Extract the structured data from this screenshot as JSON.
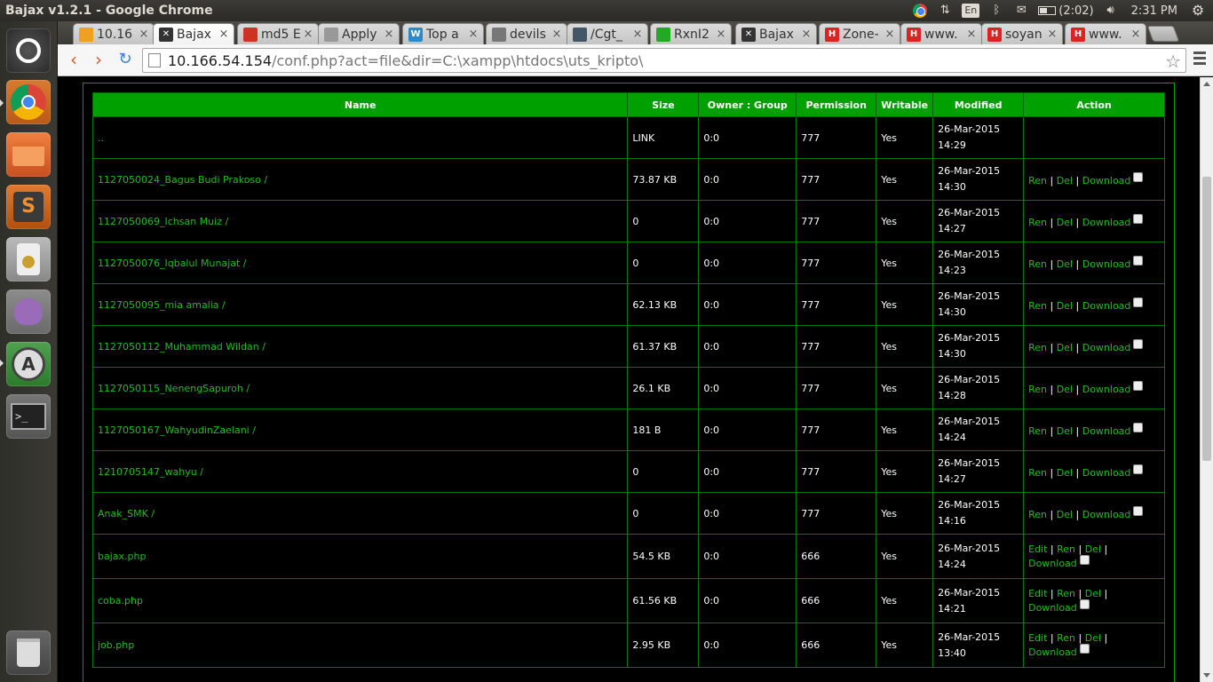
{
  "panel": {
    "window_title": "Bajax v1.2.1 - Google Chrome",
    "lang": "En",
    "battery": "(2:02)",
    "time": "2:31 PM"
  },
  "tabs": [
    {
      "label": "10.16",
      "icon": "phpmyadmin-icon",
      "color": "#f0a020"
    },
    {
      "label": "Bajax",
      "icon": "bajax-icon",
      "color": "#333333"
    },
    {
      "label": "md5 E",
      "icon": "md5-icon",
      "color": "#cc3322"
    },
    {
      "label": "Apply",
      "icon": "loading-icon",
      "color": "#999999"
    },
    {
      "label": "Top a",
      "icon": "wordpress-icon",
      "color": "#2a8bcc"
    },
    {
      "label": "devils",
      "icon": "grid-icon",
      "color": "#777777"
    },
    {
      "label": "/Cgt_",
      "icon": "globe-icon",
      "color": "#445566"
    },
    {
      "label": "RxnI2",
      "icon": "green-dot-icon",
      "color": "#22aa22"
    },
    {
      "label": "Bajax",
      "icon": "bajax-icon",
      "color": "#333333"
    },
    {
      "label": "Zone-",
      "icon": "h-icon",
      "color": "#dd2222"
    },
    {
      "label": "www.",
      "icon": "h-icon",
      "color": "#dd2222"
    },
    {
      "label": "soyan",
      "icon": "h-icon",
      "color": "#dd2222"
    },
    {
      "label": "www.",
      "icon": "h-icon",
      "color": "#dd2222"
    }
  ],
  "address": {
    "host": "10.166.54.154",
    "path": "/conf.php?act=file&dir=C:\\xampp\\htdocs\\uts_kripto\\"
  },
  "table": {
    "headers": [
      "Name",
      "Size",
      "Owner : Group",
      "Permission",
      "Writable",
      "Modified",
      "Action"
    ],
    "rows": [
      {
        "name": "..",
        "size": "LINK",
        "owner": "0:0",
        "perm": "777",
        "writable": "Yes",
        "date": "26-Mar-2015",
        "time": "14:29",
        "kind": "link"
      },
      {
        "name": "1127050024_Bagus Budi Prakoso /",
        "size": "73.87 KB",
        "owner": "0:0",
        "perm": "777",
        "writable": "Yes",
        "date": "26-Mar-2015",
        "time": "14:30",
        "kind": "dir"
      },
      {
        "name": "1127050069_Ichsan Muiz /",
        "size": "0",
        "owner": "0:0",
        "perm": "777",
        "writable": "Yes",
        "date": "26-Mar-2015",
        "time": "14:27",
        "kind": "dir"
      },
      {
        "name": "1127050076_Iqbalul Munajat /",
        "size": "0",
        "owner": "0:0",
        "perm": "777",
        "writable": "Yes",
        "date": "26-Mar-2015",
        "time": "14:23",
        "kind": "dir"
      },
      {
        "name": "1127050095_mia amalia /",
        "size": "62.13 KB",
        "owner": "0:0",
        "perm": "777",
        "writable": "Yes",
        "date": "26-Mar-2015",
        "time": "14:30",
        "kind": "dir"
      },
      {
        "name": "1127050112_Muhammad Wildan /",
        "size": "61.37 KB",
        "owner": "0:0",
        "perm": "777",
        "writable": "Yes",
        "date": "26-Mar-2015",
        "time": "14:30",
        "kind": "dir"
      },
      {
        "name": "1127050115_NenengSapuroh /",
        "size": "26.1 KB",
        "owner": "0:0",
        "perm": "777",
        "writable": "Yes",
        "date": "26-Mar-2015",
        "time": "14:28",
        "kind": "dir"
      },
      {
        "name": "1127050167_WahyudinZaelani /",
        "size": "181 B",
        "owner": "0:0",
        "perm": "777",
        "writable": "Yes",
        "date": "26-Mar-2015",
        "time": "14:24",
        "kind": "dir"
      },
      {
        "name": "1210705147_wahyu /",
        "size": "0",
        "owner": "0:0",
        "perm": "777",
        "writable": "Yes",
        "date": "26-Mar-2015",
        "time": "14:27",
        "kind": "dir"
      },
      {
        "name": "Anak_SMK /",
        "size": "0",
        "owner": "0:0",
        "perm": "777",
        "writable": "Yes",
        "date": "26-Mar-2015",
        "time": "14:16",
        "kind": "dir"
      },
      {
        "name": "bajax.php",
        "size": "54.5 KB",
        "owner": "0:0",
        "perm": "666",
        "writable": "Yes",
        "date": "26-Mar-2015",
        "time": "14:24",
        "kind": "file"
      },
      {
        "name": "coba.php",
        "size": "61.56 KB",
        "owner": "0:0",
        "perm": "666",
        "writable": "Yes",
        "date": "26-Mar-2015",
        "time": "14:21",
        "kind": "file"
      },
      {
        "name": "job.php",
        "size": "2.95 KB",
        "owner": "0:0",
        "perm": "666",
        "writable": "Yes",
        "date": "26-Mar-2015",
        "time": "13:40",
        "kind": "file"
      }
    ]
  },
  "actions": {
    "edit": "Edit",
    "ren": "Ren",
    "del": "Del",
    "download": "Download",
    "sep": "|"
  }
}
